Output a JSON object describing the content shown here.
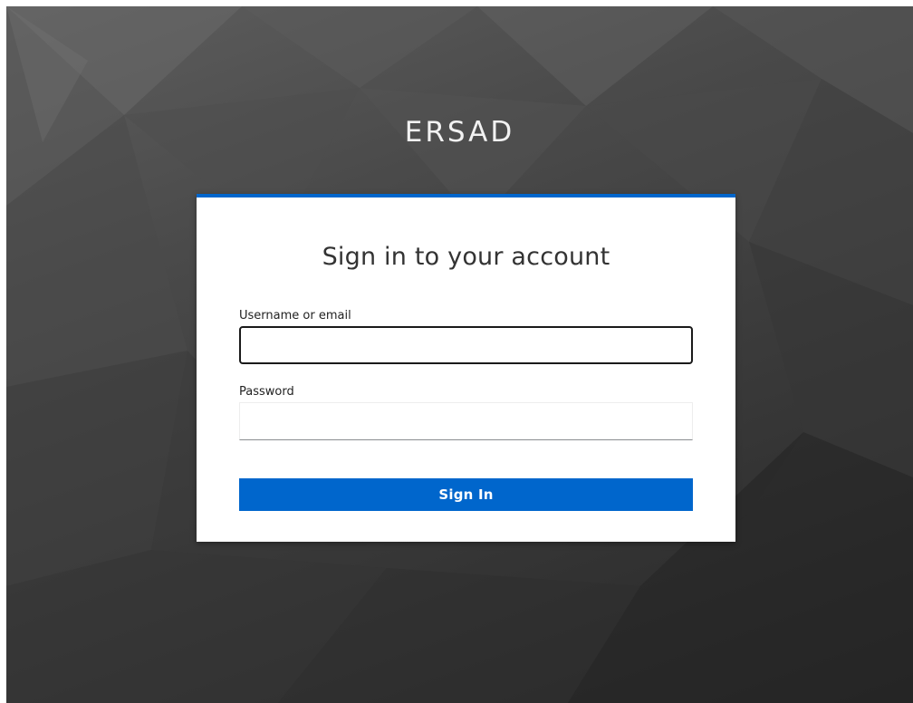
{
  "realm": {
    "title": "ERSAD"
  },
  "login": {
    "heading": "Sign in to your account",
    "username": {
      "label": "Username or email",
      "value": "",
      "placeholder": ""
    },
    "password": {
      "label": "Password",
      "value": "",
      "placeholder": ""
    },
    "submit_label": "Sign In"
  },
  "theme": {
    "accent": "#0066cc",
    "background": "#3a3a3a",
    "card": "#ffffff"
  }
}
